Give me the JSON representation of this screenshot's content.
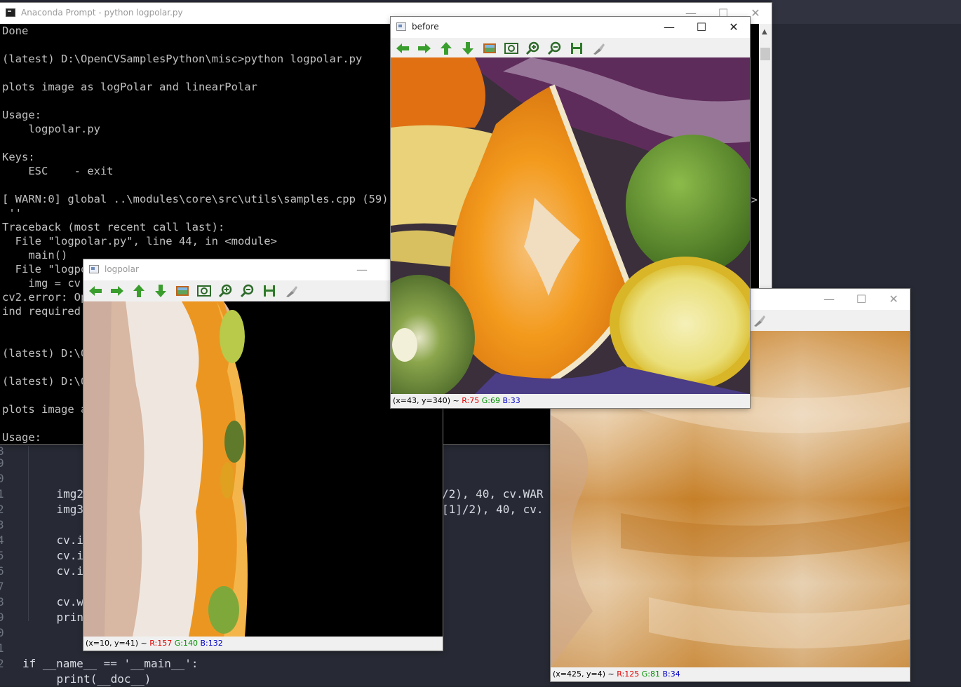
{
  "console": {
    "title": "Anaconda Prompt - python  logpolar.py",
    "lines": [
      "Done",
      "",
      "(latest) D:\\OpenCVSamplesPython\\misc>python logpolar.py",
      "",
      "plots image as logPolar and linearPolar",
      "",
      "Usage:",
      "    logpolar.py",
      "",
      "Keys:",
      "    ESC    - exit",
      "",
      "[ WARN:0] global ..\\modules\\core\\src\\utils\\samples.cpp (59) cv",
      " ''",
      "Traceback (most recent call last):",
      "  File \"logpolar.py\", line 44, in <module>",
      "    main()",
      "  File \"logpo",
      "    img = cv.",
      "cv2.error: Op",
      "ind required",
      "",
      "",
      "(latest) D:\\O",
      "",
      "(latest) D:\\O",
      "",
      "plots image a",
      "",
      "Usage:"
    ],
    "overflow_right": "=>"
  },
  "editor": {
    "lines": [
      {
        "no": "8",
        "code": ""
      },
      {
        "no": "9",
        "code": ""
      },
      {
        "no": "0",
        "code": ""
      },
      {
        "no": "1",
        "code": "    img2"
      },
      {
        "no": "2",
        "code": "    img3"
      },
      {
        "no": "3",
        "code": ""
      },
      {
        "no": "4",
        "code": "    cv.i"
      },
      {
        "no": "5",
        "code": "    cv.i"
      },
      {
        "no": "6",
        "code": "    cv.i"
      },
      {
        "no": "7",
        "code": ""
      },
      {
        "no": "8",
        "code": "    cv.wa"
      },
      {
        "no": "9",
        "code": "    print"
      },
      {
        "no": "0",
        "code": ""
      },
      {
        "no": "1",
        "code": ""
      },
      {
        "no": "2",
        "code": "if __name__ == '__main__':"
      },
      {
        "no": "",
        "code": "    print(__doc__)"
      }
    ],
    "frag_line1": "/2), 40, cv.WAR",
    "frag_line2": "[1]/2), 40, cv."
  },
  "windows": {
    "before": {
      "title": "before",
      "status": {
        "coord": "(x=43, y=340) ~ ",
        "r": "R:75",
        "g": "G:69",
        "b": "B:33"
      }
    },
    "logpolar": {
      "title": "logpolar",
      "status": {
        "coord": "(x=10, y=41) ~ ",
        "r": "R:157",
        "g": "G:140",
        "b": "B:132"
      }
    },
    "linearpolar": {
      "title": "",
      "status": {
        "coord": "(x=425, y=4) ~ ",
        "r": "R:125",
        "g": "G:81",
        "b": "B:34"
      }
    }
  },
  "controls": {
    "minimize": "—",
    "maximize": "☐",
    "close": "✕"
  },
  "toolbar_icons": [
    "arrow-left-icon",
    "arrow-right-icon",
    "arrow-up-icon",
    "arrow-down-icon",
    "image-icon",
    "zoom-fit-icon",
    "zoom-in-icon",
    "zoom-out-icon",
    "save-icon",
    "properties-icon"
  ]
}
